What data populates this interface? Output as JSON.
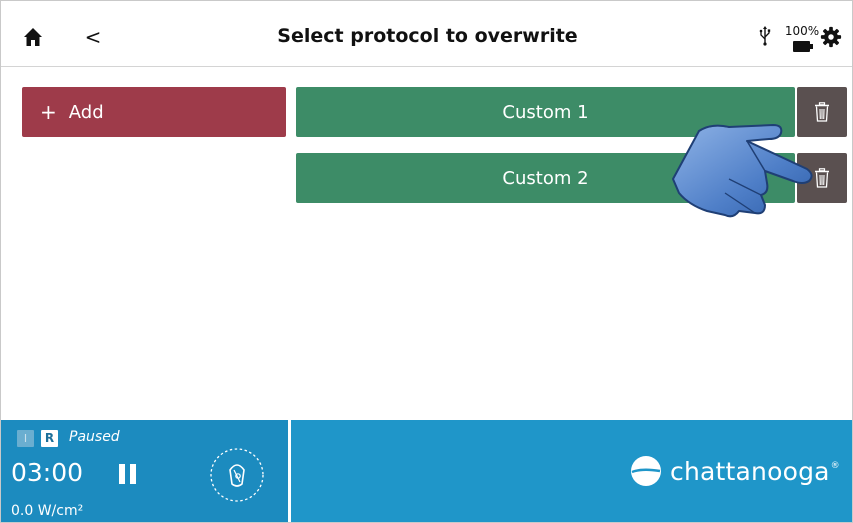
{
  "header": {
    "title": "Select protocol to overwrite",
    "back_glyph": "<",
    "battery_percent": "100%",
    "icons": [
      "home-icon",
      "back-chevron-icon",
      "usb-icon",
      "battery-icon",
      "gear-icon"
    ]
  },
  "actions": {
    "add_symbol": "+",
    "add_label": "Add"
  },
  "protocols": [
    {
      "label": "Custom 1"
    },
    {
      "label": "Custom 2"
    }
  ],
  "footer": {
    "channel_indicator": "I",
    "mode_badge": "R",
    "status": "Paused",
    "timer": "03:00",
    "intensity": "0.0 W/cm²",
    "brand": "chattanooga",
    "brand_mark": "®"
  },
  "colors": {
    "add": "#9e3b4a",
    "protocol": "#3d8c67",
    "trash": "#5a5050",
    "footer_left": "#1c8bbf",
    "footer_right": "#1f96c9"
  }
}
